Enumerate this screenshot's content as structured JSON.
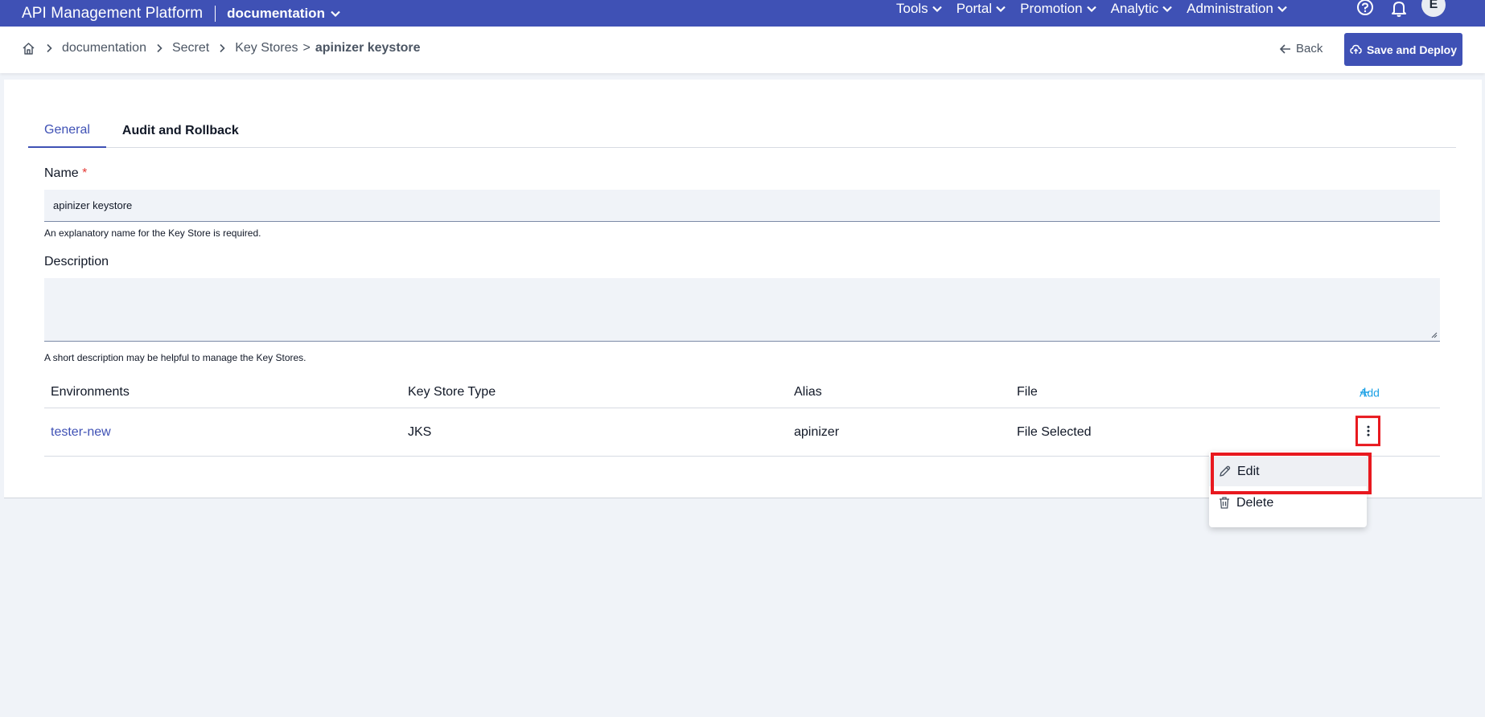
{
  "app": {
    "title": "API Management Platform",
    "workspace": "documentation"
  },
  "nav": {
    "menus": [
      {
        "label": "Tools"
      },
      {
        "label": "Portal"
      },
      {
        "label": "Promotion"
      },
      {
        "label": "Analytic"
      },
      {
        "label": "Administration"
      }
    ],
    "avatar_initial": "E"
  },
  "breadcrumb": {
    "items": [
      "documentation",
      "Secret",
      "Key Stores"
    ],
    "separator": ">",
    "current": "apinizer keystore"
  },
  "actions": {
    "back_label": "Back",
    "deploy_label": "Save and Deploy"
  },
  "tabs": [
    {
      "label": "General",
      "active": true
    },
    {
      "label": "Audit and Rollback",
      "active": false
    }
  ],
  "form": {
    "name": {
      "label": "Name",
      "required_mark": "*",
      "value": "apinizer keystore",
      "hint": "An explanatory name for the Key Store is required."
    },
    "description": {
      "label": "Description",
      "value": "",
      "hint": "A short description may be helpful to manage the Key Stores."
    }
  },
  "table": {
    "columns": [
      "Environments",
      "Key Store Type",
      "Alias",
      "File"
    ],
    "add_label": "Add",
    "rows": [
      {
        "environment": "tester-new",
        "type": "JKS",
        "alias": "apinizer",
        "file": "File Selected"
      }
    ]
  },
  "row_menu": {
    "items": [
      {
        "label": "Edit",
        "icon": "pencil-icon"
      },
      {
        "label": "Delete",
        "icon": "trash-icon"
      }
    ]
  },
  "colors": {
    "primary": "#3f51b5",
    "accent_link": "#1ea2e6",
    "highlight_border": "#e8191f",
    "required": "#e53935",
    "page_bg": "#f0f3f8"
  }
}
